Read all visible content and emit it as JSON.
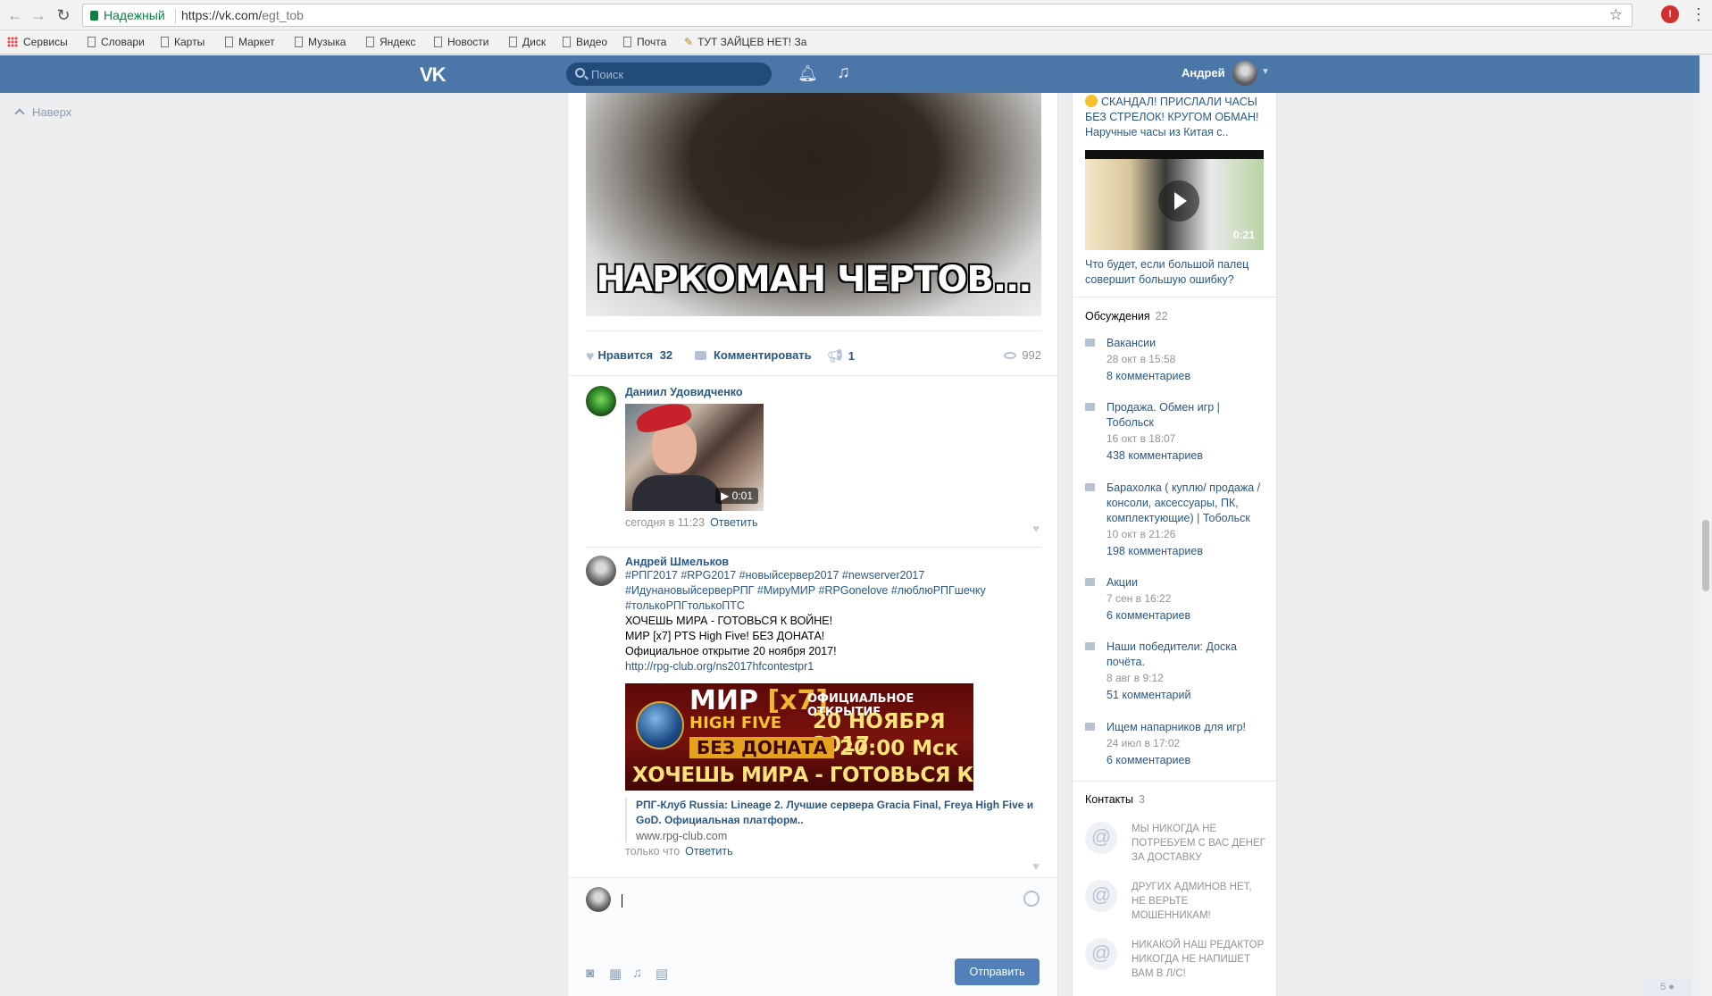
{
  "browser": {
    "secure_label": "Надежный",
    "url_main": "https://vk.com/",
    "url_path": "egt_tob",
    "bookmarks": [
      "Сервисы",
      "Словари",
      "Карты",
      "Маркет",
      "Музыка",
      "Яндекс",
      "Новости",
      "Диск",
      "Видео",
      "Почта",
      "ТУТ ЗАЙЦЕВ НЕТ! За"
    ]
  },
  "header": {
    "search_placeholder": "Поиск",
    "user_name": "Андрей"
  },
  "sidebar": {
    "to_top": "Наверх"
  },
  "post": {
    "image_caption": "НАРКОМАН ЧЕРТОВ...",
    "like_label": "Нравится",
    "like_count": "32",
    "comment_label": "Комментировать",
    "share_count": "1",
    "views": "992"
  },
  "comments": [
    {
      "author": "Даниил Удовидченко",
      "video_duration": "0:01",
      "time": "сегодня в 11:23",
      "reply": "Ответить"
    },
    {
      "author": "Андрей Шмельков",
      "tags_line1": "#РПГ2017 #RPG2017 #новыйсервер2017 #newserver2017",
      "tags_line2": "#ИдунановыйсерверРПГ #МируМИР #RPGonelove #люблюРПГшечку",
      "tags_line3": "#толькоРПГтолькоПТС",
      "line1": "ХОЧЕШЬ МИРА - ГОТОВЬСЯ К ВОЙНЕ!",
      "line2": "МИР [x7] PTS High Five! БЕЗ ДОНАТА!",
      "line3": "Официальное открытие 20 ноября 2017!",
      "link": "http://rpg-club.org/ns2017hfcontestpr1",
      "banner": {
        "mir": "МИР",
        "x7": "[x7]",
        "official": "ОФИЦИАЛЬНОЕ ОТКРЫТИЕ",
        "high_five": "HIGH FIVE",
        "date": "20 НОЯБРЯ 2017",
        "no_donate": "БЕЗ ДОНАТА",
        "time": "20:00 Мск",
        "slogan": "ХОЧЕШЬ МИРА - ГОТОВЬСЯ К ВОЙНЕ"
      },
      "snippet_title": "РПГ-Клуб Russia: Lineage 2. Лучшие сервера Gracia Final, Freya High Five и GoD. Официальная платформ..",
      "snippet_domain": "www.rpg-club.com",
      "time": "только что",
      "reply": "Ответить"
    }
  ],
  "reply_box": {
    "send_label": "Отправить"
  },
  "right": {
    "ad_title": "СКАНДАЛ! ПРИСЛАЛИ ЧАСЫ БЕЗ СТРЕЛОК! КРУГОМ ОБМАН! Наручные часы из Китая с..",
    "ad_video_duration": "0:21",
    "ad_caption": "Что будет, если большой палец совершит большую ошибку?",
    "discussions_label": "Обсуждения",
    "discussions_count": "22",
    "topics": [
      {
        "title": "Вакансии",
        "date": "28 окт в 15:58",
        "comments": "8 комментариев"
      },
      {
        "title": "Продажа. Обмен игр | Тобольск",
        "date": "16 окт в 18:07",
        "comments": "438 комментариев"
      },
      {
        "title": "Барахолка ( куплю/ продажа / консоли, аксессуары, ПК, комплектующие) | Тобольск",
        "date": "10 окт в 21:26",
        "comments": "198 комментариев"
      },
      {
        "title": "Акции",
        "date": "7 сен в 16:22",
        "comments": "6 комментариев"
      },
      {
        "title": "Наши победители: Доска почёта.",
        "date": "8 авг в 9:12",
        "comments": "51 комментарий"
      },
      {
        "title": "Ищем напарников для игр!",
        "date": "24 июл в 17:02",
        "comments": "6 комментариев"
      }
    ],
    "contacts_label": "Контакты",
    "contacts_count": "3",
    "contacts": [
      "МЫ НИКОГДА НЕ ПОТРЕБУЕМ С ВАС ДЕНЕГ ЗА ДОСТАВКУ",
      "ДРУГИХ АДМИНОВ НЕТ, НЕ ВЕРЬТЕ МОШЕННИКАМ!",
      "НИКАКОЙ НАШ РЕДАКТОР НИКОГДА НЕ НАПИШЕТ ВАМ В Л/С!"
    ]
  },
  "corner_badge": "5"
}
